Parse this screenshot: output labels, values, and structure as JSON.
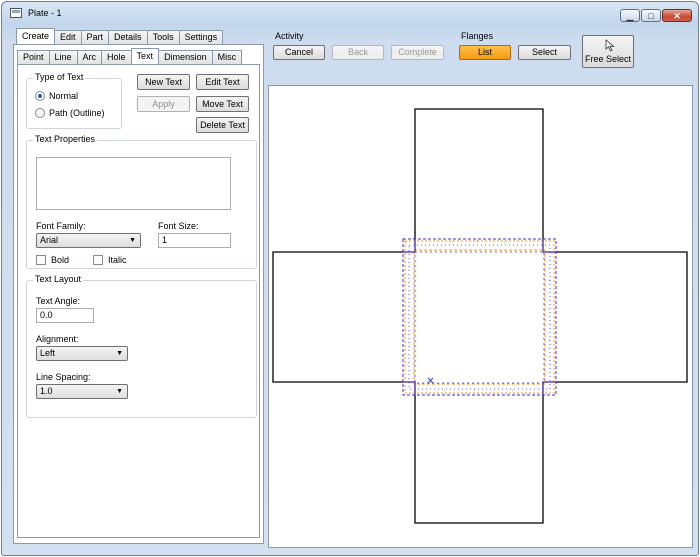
{
  "window": {
    "title": "Plate - 1"
  },
  "main_tabs": [
    {
      "label": "Create"
    },
    {
      "label": "Edit"
    },
    {
      "label": "Part"
    },
    {
      "label": "Details"
    },
    {
      "label": "Tools"
    },
    {
      "label": "Settings"
    }
  ],
  "sub_tabs": [
    {
      "label": "Point"
    },
    {
      "label": "Line"
    },
    {
      "label": "Arc"
    },
    {
      "label": "Hole"
    },
    {
      "label": "Text"
    },
    {
      "label": "Dimension"
    },
    {
      "label": "Misc"
    }
  ],
  "type_of_text": {
    "title": "Type of Text",
    "normal_label": "Normal",
    "path_label": "Path (Outline)",
    "selected": "Normal"
  },
  "text_actions": {
    "new_text": "New Text",
    "edit_text": "Edit Text",
    "apply": "Apply",
    "move_text": "Move Text",
    "delete_text": "Delete Text"
  },
  "text_properties": {
    "title": "Text Properties",
    "text_value": "",
    "font_family_label": "Font Family:",
    "font_family_value": "Arial",
    "font_size_label": "Font Size:",
    "font_size_value": "1",
    "bold_label": "Bold",
    "italic_label": "Italic"
  },
  "text_layout": {
    "title": "Text Layout",
    "angle_label": "Text Angle:",
    "angle_value": "0.0",
    "alignment_label": "Alignment:",
    "alignment_value": "Left",
    "spacing_label": "Line Spacing:",
    "spacing_value": "1.0"
  },
  "activity": {
    "label": "Activity",
    "cancel": "Cancel",
    "back": "Back",
    "complete": "Complete"
  },
  "flanges": {
    "label": "Flanges",
    "list": "List",
    "select": "Select",
    "free_select": "Free Select"
  },
  "colors": {
    "active_button": "#f59b10",
    "outline": "#000000",
    "flange_purple": "#4a2bd6",
    "flange_orange": "#f59b10",
    "flange_green": "#2e9b2e"
  }
}
